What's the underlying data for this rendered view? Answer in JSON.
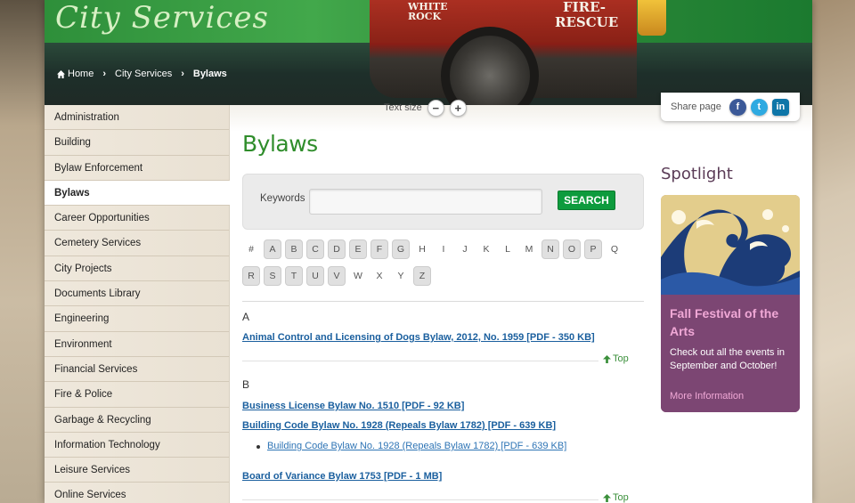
{
  "header": {
    "site_title": "City Services",
    "truck_text_small": "WHITE ROCK",
    "truck_text_large": "FIRE-RESCUE"
  },
  "breadcrumb": {
    "home": "Home",
    "section": "City Services",
    "current": "Bylaws"
  },
  "toolbar": {
    "text_size_label": "Text size",
    "decrease": "−",
    "increase": "+",
    "share_label": "Share page",
    "facebook": "f",
    "twitter": "t",
    "linkedin": "in"
  },
  "sidebar": {
    "items": [
      {
        "label": "Administration"
      },
      {
        "label": "Building"
      },
      {
        "label": "Bylaw Enforcement"
      },
      {
        "label": "Bylaws"
      },
      {
        "label": "Career Opportunities"
      },
      {
        "label": "Cemetery Services"
      },
      {
        "label": "City Projects"
      },
      {
        "label": "Documents Library"
      },
      {
        "label": "Engineering"
      },
      {
        "label": "Environment"
      },
      {
        "label": "Financial Services"
      },
      {
        "label": "Fire & Police"
      },
      {
        "label": "Garbage & Recycling"
      },
      {
        "label": "Information Technology"
      },
      {
        "label": "Leisure Services"
      },
      {
        "label": "Online Services"
      }
    ],
    "active_index": 3
  },
  "main": {
    "title": "Bylaws",
    "search": {
      "keywords_label": "Keywords",
      "value": "",
      "placeholder": "",
      "button_label": "SEARCH"
    },
    "alphabet_row1": [
      "#",
      "A",
      "B",
      "C",
      "D",
      "E",
      "F",
      "G",
      "H",
      "I",
      "J",
      "K",
      "L",
      "M",
      "N",
      "O",
      "P",
      "Q"
    ],
    "alphabet_row2": [
      "R",
      "S",
      "T",
      "U",
      "V",
      "W",
      "X",
      "Y",
      "Z"
    ],
    "active_letters": [
      "A",
      "B",
      "C",
      "D",
      "E",
      "F",
      "G",
      "N",
      "O",
      "P",
      "R",
      "S",
      "T",
      "U",
      "V",
      "Z"
    ],
    "section_a": {
      "letter": "A",
      "links": [
        "Animal Control and Licensing of Dogs Bylaw, 2012, No. 1959 [PDF - 350 KB]"
      ],
      "top_label": "Top"
    },
    "section_b": {
      "letter": "B",
      "link1": "Business License Bylaw No. 1510 [PDF - 92 KB]",
      "link2": "Building Code Bylaw No. 1928 (Repeals Bylaw 1782) [PDF - 639 KB]",
      "sub_link": "Building Code Bylaw No. 1928 (Repeals Bylaw 1782) [PDF - 639 KB]",
      "link3": "Board of Variance Bylaw 1753 [PDF - 1 MB]",
      "top_label": "Top"
    }
  },
  "spotlight": {
    "title": "Spotlight",
    "heading": "Fall Festival of the Arts",
    "text": "Check out all the events in September and October!",
    "more": "More Information"
  },
  "colors": {
    "accent_green": "#2f8d2b",
    "search_button": "#0e9b3d",
    "link_blue": "#1a5f9e",
    "spotlight_purple": "#7c4673",
    "spotlight_pink": "#f0a8d6"
  }
}
